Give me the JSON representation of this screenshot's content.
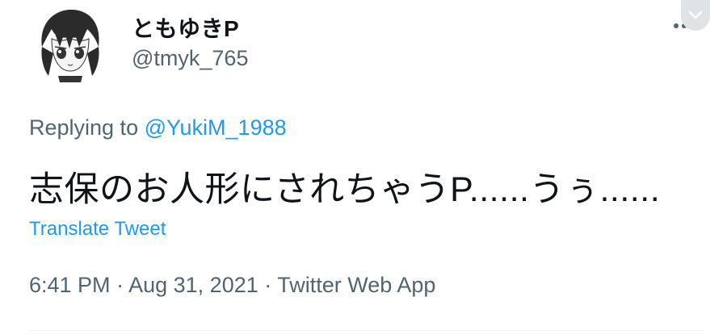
{
  "author": {
    "display_name": "ともゆきP",
    "handle": "@tmyk_765",
    "avatar_icon": "anime-character-avatar"
  },
  "reply": {
    "prefix": "Replying to",
    "mention": "@YukiM_1988"
  },
  "tweet": {
    "text": "志保のお人形にされちゃうP......うぅ......",
    "translate_label": "Translate Tweet"
  },
  "meta": {
    "time": "6:41 PM",
    "separator": "·",
    "date": "Aug 31, 2021",
    "source": "Twitter Web App"
  },
  "icons": {
    "more": "more-horizontal-icon",
    "chevron": "chevron-down-icon"
  },
  "colors": {
    "link": "#1d9bf0",
    "secondary_text": "#536471",
    "primary_text": "#0f1419"
  }
}
